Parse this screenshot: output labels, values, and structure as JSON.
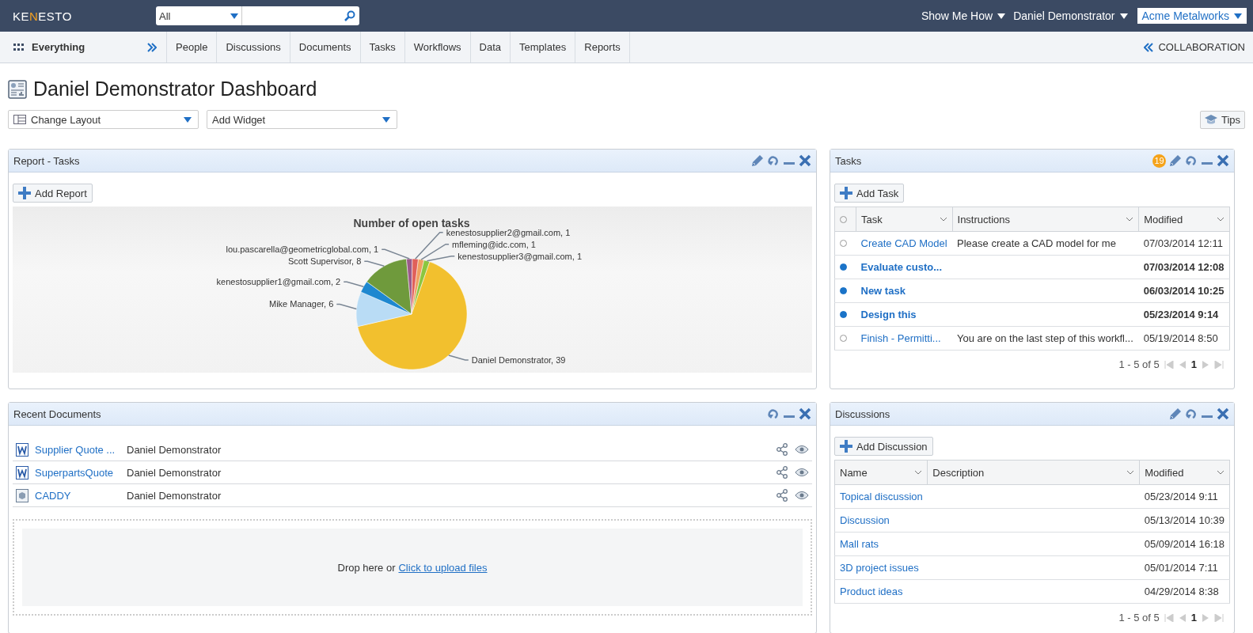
{
  "top_bar": {
    "logo": [
      {
        "text": "KE",
        "accent": false
      },
      {
        "text": "N",
        "accent": true
      },
      {
        "text": "ESTO",
        "accent": false
      }
    ],
    "search_scope": "All",
    "menus": [
      "Show Me How",
      "Daniel Demonstrator"
    ],
    "company": "Acme Metalworks"
  },
  "nav": {
    "home": "Everything",
    "tabs": [
      {
        "label": "People",
        "selected": false
      },
      {
        "label": "Discussions",
        "selected": false
      },
      {
        "label": "Documents",
        "selected": false
      },
      {
        "label": "Tasks",
        "selected": false
      },
      {
        "label": "Workflows",
        "selected": false
      },
      {
        "label": "Data",
        "selected": false
      },
      {
        "label": "Templates",
        "selected": false
      },
      {
        "label": "Reports",
        "selected": false
      }
    ],
    "right": "COLLABORATION"
  },
  "page_title": "Daniel Demonstrator Dashboard",
  "toolbar": {
    "layout_select": "Change Layout",
    "widget_select": "Add Widget",
    "tips": "Tips"
  },
  "report_widget": {
    "title": "Report - Tasks",
    "editable": true,
    "add_button": "Add Report",
    "chart_data": {
      "type": "pie",
      "title": "Number of open tasks",
      "value_labels": [
        "mfleming@idc.com, 1",
        "kenestosupplier3@gmail.com, 1",
        "Daniel Demonstrator, 39",
        "Mike Manager, 6",
        "kenestosupplier1@gmail.com, 2",
        "Scott Supervisor, 8",
        "lou.pascarella@geometricglobal.com, 1",
        "kenestosupplier2@gmail.com, 1"
      ],
      "values": [
        1,
        1,
        39,
        6,
        2,
        8,
        1,
        1
      ]
    }
  },
  "tasks_widget": {
    "title": "Tasks",
    "badge": "19",
    "editable": true,
    "add_button": "Add Task",
    "all_selected": false,
    "columns": [
      "Task",
      "Instructions",
      "Modified"
    ],
    "rows": [
      {
        "task": "Create CAD Model",
        "instructions": "Please create a CAD model for me",
        "modified": "07/03/2014 12:11",
        "unread": false
      },
      {
        "task": "Evaluate custo...",
        "modified": "07/03/2014 12:08",
        "unread": true
      },
      {
        "task": "New task",
        "modified": "06/03/2014 10:25",
        "unread": true
      },
      {
        "task": "Design this",
        "modified": "05/23/2014 9:14",
        "unread": true
      },
      {
        "task": "Finish - Permitti...",
        "instructions": "You are on the last step of this workfl...",
        "modified": "05/19/2014 8:50",
        "unread": false
      }
    ],
    "pager": {
      "summary": "1 - 5 of 5",
      "page": "1"
    }
  },
  "documents_widget": {
    "title": "Recent Documents",
    "editable": false,
    "rows": [
      {
        "kind": "word",
        "name": "Supplier Quote ...",
        "owner": "Daniel Demonstrator"
      },
      {
        "kind": "word",
        "name": "SuperpartsQuote",
        "owner": "Daniel Demonstrator"
      },
      {
        "kind": "cad",
        "name": "CADDY",
        "owner": "Daniel Demonstrator"
      }
    ],
    "drop_text": "Drop here or",
    "upload_link": "Click to upload files"
  },
  "discussions_widget": {
    "title": "Discussions",
    "editable": true,
    "add_button": "Add Discussion",
    "columns": [
      "Name",
      "Description",
      "Modified"
    ],
    "rows": [
      {
        "name": "Topical discussion",
        "modified": "05/23/2014 9:11"
      },
      {
        "name": "Discussion",
        "modified": "05/13/2014 10:39"
      },
      {
        "name": "Mall rats",
        "modified": "05/09/2014 16:18"
      },
      {
        "name": "3D project issues",
        "modified": "05/01/2014 7:11"
      },
      {
        "name": "Product ideas",
        "modified": "04/29/2014 8:38"
      }
    ],
    "pager": {
      "summary": "1 - 5 of 5",
      "page": "1"
    }
  }
}
